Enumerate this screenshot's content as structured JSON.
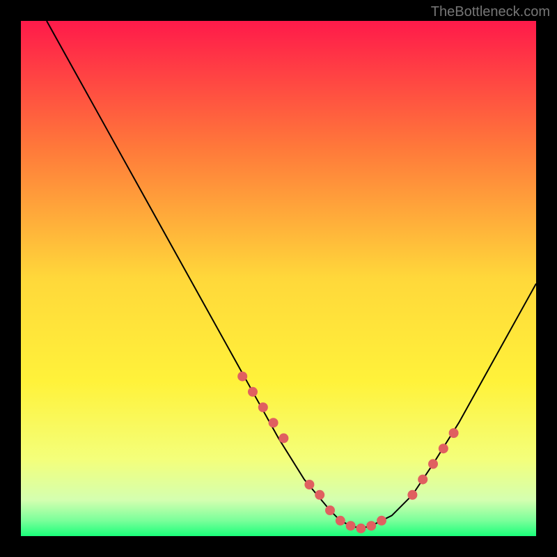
{
  "watermark": "TheBottleneck.com",
  "chart_data": {
    "type": "line",
    "title": "",
    "xlabel": "",
    "ylabel": "",
    "xlim": [
      0,
      100
    ],
    "ylim": [
      0,
      100
    ],
    "gradient_stops": [
      {
        "offset": 0,
        "color": "#ff1a4a"
      },
      {
        "offset": 25,
        "color": "#ff7a3a"
      },
      {
        "offset": 50,
        "color": "#ffd83a"
      },
      {
        "offset": 70,
        "color": "#fff23a"
      },
      {
        "offset": 85,
        "color": "#f4ff7a"
      },
      {
        "offset": 93,
        "color": "#d4ffb0"
      },
      {
        "offset": 97,
        "color": "#7aff9a"
      },
      {
        "offset": 100,
        "color": "#1aff7a"
      }
    ],
    "series": [
      {
        "name": "curve",
        "color": "#000000",
        "x": [
          5,
          10,
          15,
          20,
          25,
          30,
          35,
          40,
          45,
          50,
          55,
          60,
          62,
          64,
          66,
          68,
          72,
          76,
          80,
          85,
          90,
          95,
          100
        ],
        "y": [
          100,
          91,
          82,
          73,
          64,
          55,
          46,
          37,
          28,
          19,
          11,
          5,
          3,
          2,
          1.5,
          2,
          4,
          8,
          14,
          22,
          31,
          40,
          49
        ]
      }
    ],
    "marker_points": {
      "name": "highlight-dots",
      "color": "#e06060",
      "x": [
        43,
        45,
        47,
        49,
        51,
        56,
        58,
        60,
        62,
        64,
        66,
        68,
        70,
        76,
        78,
        80,
        82,
        84
      ],
      "y": [
        31,
        28,
        25,
        22,
        19,
        10,
        8,
        5,
        3,
        2,
        1.5,
        2,
        3,
        8,
        11,
        14,
        17,
        20
      ]
    }
  }
}
